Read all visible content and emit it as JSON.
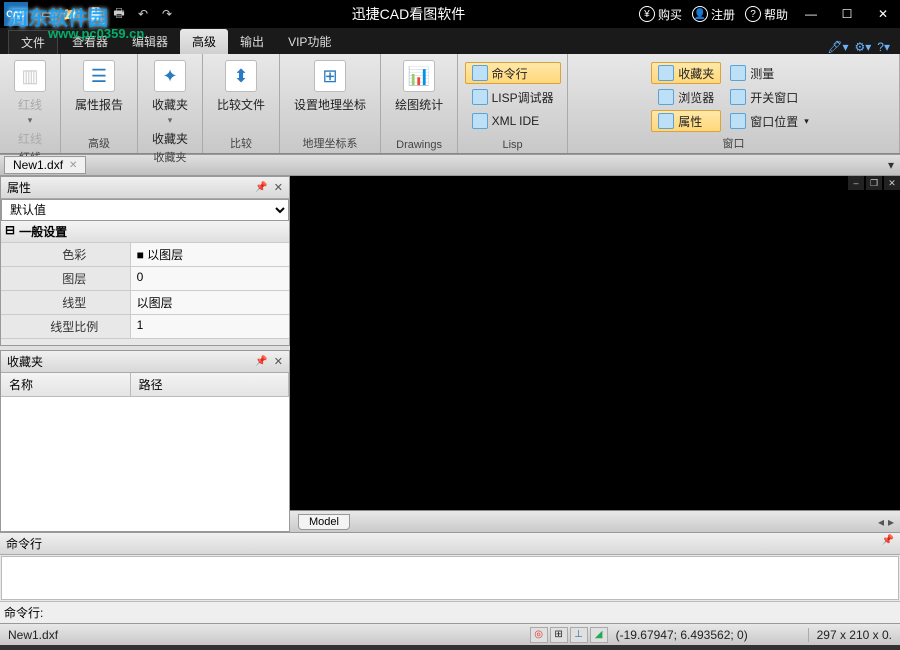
{
  "titlebar": {
    "logo_text": "CAD",
    "app_title": "迅捷CAD看图软件",
    "buy": "购买",
    "register": "注册",
    "help": "帮助"
  },
  "watermark": {
    "text": "河东软件园",
    "url": "www.pc0359.cn"
  },
  "tabs": {
    "app_menu": "文件",
    "items": [
      "查看器",
      "编辑器",
      "高级",
      "输出",
      "VIP功能"
    ],
    "active_index": 2
  },
  "ribbon": {
    "groups": [
      {
        "label": "红线",
        "big": [
          {
            "label": "红线",
            "sub": "红线",
            "arrow": true
          }
        ],
        "disabled": true
      },
      {
        "label": "高级",
        "big": [
          {
            "label": "属性报告"
          }
        ]
      },
      {
        "label": "收藏夹",
        "big": [
          {
            "label": "收藏夹",
            "sub": "收藏夹",
            "arrow": true
          }
        ]
      },
      {
        "label": "比较",
        "big": [
          {
            "label": "比较文件"
          }
        ]
      },
      {
        "label": "地理坐标系",
        "big": [
          {
            "label": "设置地理坐标"
          }
        ]
      },
      {
        "label": "Drawings",
        "big": [
          {
            "label": "绘图统计"
          }
        ]
      },
      {
        "label": "Lisp",
        "small": [
          {
            "label": "命令行",
            "hl": true
          },
          {
            "label": "LISP调试器"
          },
          {
            "label": "XML IDE"
          }
        ]
      },
      {
        "label": "窗口",
        "small_cols": [
          [
            {
              "label": "收藏夹",
              "hl": true
            },
            {
              "label": "浏览器"
            },
            {
              "label": "属性",
              "hl": true
            }
          ],
          [
            {
              "label": "测量"
            },
            {
              "label": "开关窗口"
            },
            {
              "label": "窗口位置",
              "arrow": true
            }
          ]
        ]
      }
    ]
  },
  "doc_tabs": {
    "active": "New1.dxf"
  },
  "properties": {
    "title": "属性",
    "selector": "默认值",
    "section": "一般设置",
    "rows": [
      {
        "k": "色彩",
        "v": "■ 以图层"
      },
      {
        "k": "图层",
        "v": "0"
      },
      {
        "k": "线型",
        "v": "以图层"
      },
      {
        "k": "线型比例",
        "v": "1"
      }
    ]
  },
  "favorites": {
    "title": "收藏夹",
    "cols": [
      "名称",
      "路径"
    ]
  },
  "model_tabs": {
    "active": "Model"
  },
  "command": {
    "title": "命令行",
    "prompt": "命令行:"
  },
  "status": {
    "file": "New1.dxf",
    "coords": "(-19.67947; 6.493562; 0)",
    "dims": "297 x 210 x 0."
  }
}
